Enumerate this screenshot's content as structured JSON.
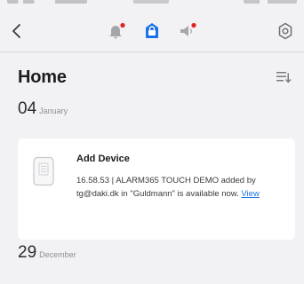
{
  "nav": {
    "back_icon": "chevron-left-icon",
    "alarm_icon": "bell-icon",
    "lock_icon": "lock-icon",
    "siren_icon": "speaker-icon",
    "settings_icon": "gear-icon"
  },
  "colors": {
    "accent": "#1a73e8",
    "alert_dot": "#e02424",
    "background": "#f2f2f4",
    "card": "#ffffff"
  },
  "page": {
    "title": "Home"
  },
  "groups": [
    {
      "day": "04",
      "month": "January",
      "events": [
        {
          "title": "Add Device",
          "body": "16.58.53 | ALARM365 TOUCH DEMO added by tg@daki.dk in \"Guldmann\" is available now.",
          "link": "View"
        }
      ]
    },
    {
      "day": "29",
      "month": "December"
    }
  ]
}
